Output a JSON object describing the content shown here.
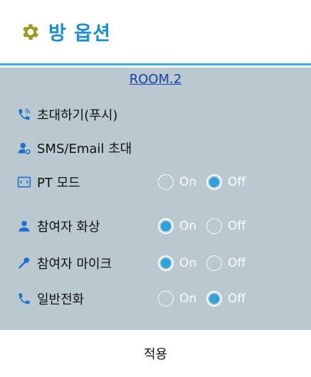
{
  "header": {
    "title": "방 옵션",
    "icon": "gear-icon",
    "title_color": "#1a8fd1"
  },
  "room_link": "ROOM.2",
  "actions": [
    {
      "label": "초대하기(푸시)",
      "icon": "phone-ring-icon"
    },
    {
      "label": "SMS/Email 초대",
      "icon": "add-person-icon"
    }
  ],
  "options": [
    {
      "label": "PT 모드",
      "icon": "screen-icon",
      "on_label": "On",
      "off_label": "Off",
      "selected": "off"
    },
    {
      "label": "참여자 화상",
      "icon": "person-icon",
      "on_label": "On",
      "off_label": "Off",
      "selected": "on"
    },
    {
      "label": "참여자 마이크",
      "icon": "microphone-icon",
      "on_label": "On",
      "off_label": "Off",
      "selected": "on"
    },
    {
      "label": "일반전화",
      "icon": "phone-icon",
      "on_label": "On",
      "off_label": "Off",
      "selected": "off"
    }
  ],
  "footer": {
    "apply_label": "적용"
  },
  "colors": {
    "accent": "#2aa5dc",
    "panel": "#b9c9cf",
    "divider": "#35b3e0"
  }
}
